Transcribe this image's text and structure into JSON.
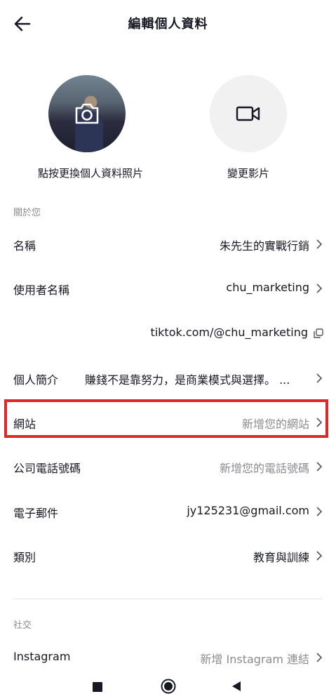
{
  "header": {
    "title": "編輯個人資料"
  },
  "profile": {
    "avatar_label": "點按更換個人資料照片",
    "video_label": "變更影片"
  },
  "about_section": {
    "heading": "關於您",
    "rows": [
      {
        "label": "名稱",
        "value": "朱先生的實戰行銷"
      },
      {
        "label": "使用者名稱",
        "value": "chu_marketing"
      },
      {
        "label": "個人簡介",
        "value": "賺錢不是靠努力，是商業模式與選擇。 ..."
      },
      {
        "label": "網站",
        "value": "新增您的網站"
      },
      {
        "label": "公司電話號碼",
        "value": "新增您的電話號碼"
      },
      {
        "label": "電子郵件",
        "value": "jy125231@gmail.com"
      },
      {
        "label": "類別",
        "value": "教育與訓練"
      }
    ],
    "profile_link": "tiktok.com/@chu_marketing"
  },
  "social_section": {
    "heading": "社交",
    "rows": [
      {
        "label": "Instagram",
        "value": "新增 Instagram 連結"
      }
    ]
  },
  "colors": {
    "highlight": "#e02626",
    "placeholder": "#8a8b91",
    "text": "#161823"
  }
}
